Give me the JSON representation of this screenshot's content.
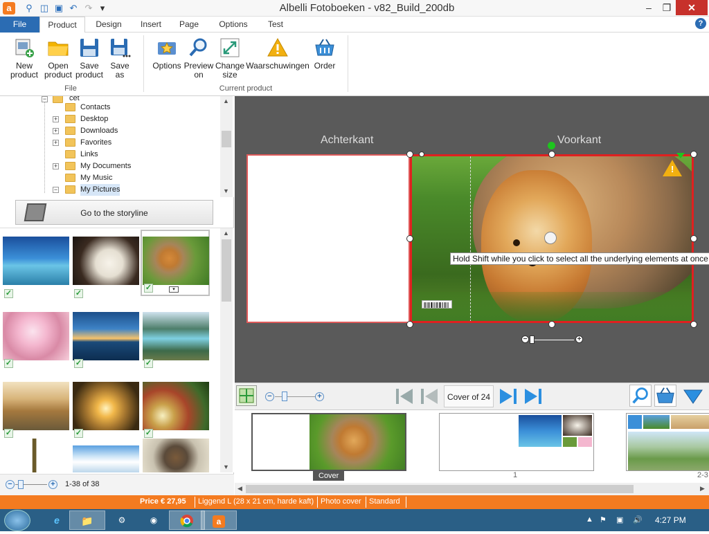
{
  "window": {
    "title": "Albelli Fotoboeken - v82_Build_200db",
    "app_logo": "a",
    "minimize": "–",
    "maximize": "❐",
    "close": "✕"
  },
  "quick_access": {
    "icons": [
      "search-icon",
      "open-icon",
      "save-icon",
      "undo-icon",
      "redo-icon",
      "dropdown-icon"
    ]
  },
  "tabs": [
    "File",
    "Product",
    "Design",
    "Insert",
    "Page",
    "Options",
    "Test"
  ],
  "help_label": "?",
  "ribbon": {
    "file_group": {
      "label": "File",
      "buttons": [
        {
          "line1": "New",
          "line2": "product"
        },
        {
          "line1": "Open",
          "line2": "product"
        },
        {
          "line1": "Save",
          "line2": "product"
        },
        {
          "line1": "Save",
          "line2": "as"
        }
      ]
    },
    "current_group": {
      "label": "Current product",
      "buttons": [
        {
          "line1": "Options",
          "line2": ""
        },
        {
          "line1": "Preview",
          "line2": "on"
        },
        {
          "line1": "Change",
          "line2": "size"
        },
        {
          "line1": "Waarschuwingen",
          "line2": ""
        },
        {
          "line1": "Order",
          "line2": ""
        }
      ]
    }
  },
  "tree": {
    "top_partial": "cet",
    "items": [
      {
        "label": "Contacts",
        "expandable": false
      },
      {
        "label": "Desktop",
        "expandable": true
      },
      {
        "label": "Downloads",
        "expandable": true
      },
      {
        "label": "Favorites",
        "expandable": true
      },
      {
        "label": "Links",
        "expandable": false
      },
      {
        "label": "My Documents",
        "expandable": true
      },
      {
        "label": "My Music",
        "expandable": false
      },
      {
        "label": "My Pictures",
        "expandable": true
      }
    ]
  },
  "storyline_button": "Go to the storyline",
  "photo_count": "1-38 of 38",
  "editor": {
    "back_label": "Achterkant",
    "front_label": "Voorkant",
    "tooltip": "Hold Shift while you click to select all the underlying elements at once"
  },
  "navigation": {
    "page_indicator": "Cover of 24"
  },
  "filmstrip": {
    "cover_label": "Cover",
    "page1_label": "1",
    "page2_label": "2-3"
  },
  "status": {
    "price": "Price € 27,95",
    "format": "Liggend L (28 x 21 cm, harde kaft)",
    "cover": "Photo cover",
    "paper": "Standard"
  },
  "taskbar": {
    "time": "4:27 PM"
  },
  "colors": {
    "accent": "#f47b20",
    "file_tab": "#2b6cb3",
    "selection_border": "#e02020",
    "taskbar": "#2a5f86"
  }
}
